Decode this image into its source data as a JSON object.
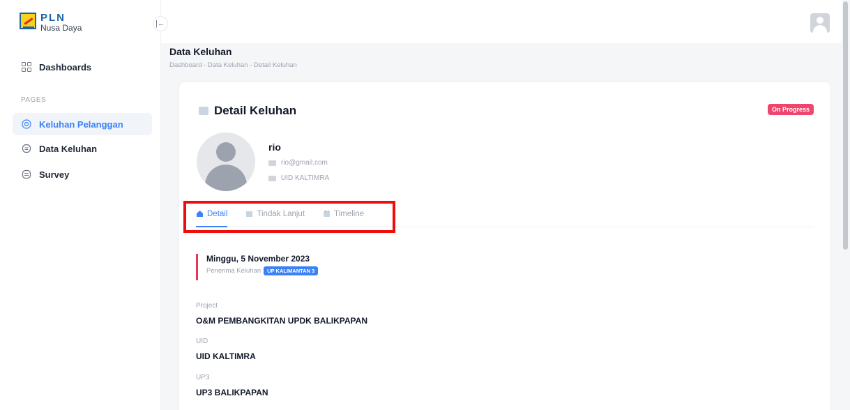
{
  "brand": {
    "name": "PLN",
    "subtitle": "Nusa Daya"
  },
  "sidebar": {
    "section_label": "PAGES",
    "items": [
      {
        "label": "Dashboards",
        "icon": "grid-icon"
      },
      {
        "label": "Keluhan Pelanggan",
        "icon": "support-icon",
        "active": true
      },
      {
        "label": "Data Keluhan",
        "icon": "clipboard-icon"
      },
      {
        "label": "Survey",
        "icon": "list-icon"
      }
    ]
  },
  "header": {
    "title": "Data Keluhan",
    "breadcrumb": "Dashboard  -  Data Keluhan  -  Detail Keluhan"
  },
  "card": {
    "title": "Detail Keluhan",
    "status": "On Progress",
    "status_color": "#f0456d"
  },
  "profile": {
    "name": "rio",
    "email": "rio@gmail.com",
    "unit": "UID KALTIMRA"
  },
  "tabs": [
    {
      "label": "Detail",
      "active": true
    },
    {
      "label": "Tindak Lanjut"
    },
    {
      "label": "Timeline"
    }
  ],
  "detail": {
    "date": "Minggu, 5 November 2023",
    "receiver_label": "Penerima Keluhan",
    "receiver_value": "UP KALIMANTAN 3",
    "fields": [
      {
        "label": "Project",
        "value": "O&M PEMBANGKITAN UPDK BALIKPAPAN"
      },
      {
        "label": "UID",
        "value": "UID KALTIMRA"
      },
      {
        "label": "UP3",
        "value": "UP3 BALIKPAPAN"
      }
    ]
  },
  "colors": {
    "accent": "#3b82f6",
    "highlight": "#ee0d0d"
  }
}
